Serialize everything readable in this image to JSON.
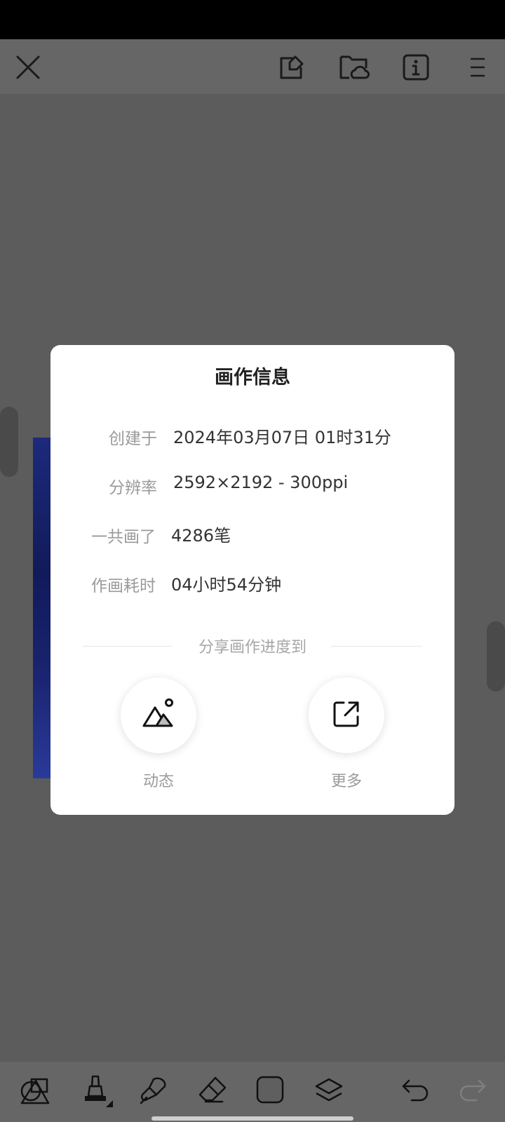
{
  "dialog": {
    "title": "画作信息",
    "rows": [
      {
        "label": "创建于",
        "value": "2024年03月07日 01时31分"
      },
      {
        "label": "分辨率",
        "value": "2592×2192 - 300ppi"
      },
      {
        "label": "一共画了",
        "value": "4286笔"
      },
      {
        "label": "作画耗时",
        "value": "04小时54分钟"
      }
    ],
    "share_title": "分享画作进度到",
    "share_targets": [
      {
        "label": "动态",
        "icon": "mountain-image-icon"
      },
      {
        "label": "更多",
        "icon": "external-share-icon"
      }
    ]
  },
  "top_toolbar": {
    "icons": [
      "close-icon",
      "edit-tag-icon",
      "cloud-folder-icon",
      "info-icon",
      "menu-icon"
    ]
  },
  "bottom_toolbar": {
    "icons": [
      "shapes-icon",
      "marker-pen-icon",
      "smudge-brush-icon",
      "eraser-icon",
      "color-swatch-icon",
      "layers-icon",
      "undo-icon",
      "redo-icon"
    ]
  },
  "colors": {
    "overlay_gray": "#5c5c5c",
    "toolbar_gray": "#666666",
    "dialog_bg": "#ffffff",
    "label_gray": "#9a9a9a",
    "value_dark": "#333333"
  }
}
